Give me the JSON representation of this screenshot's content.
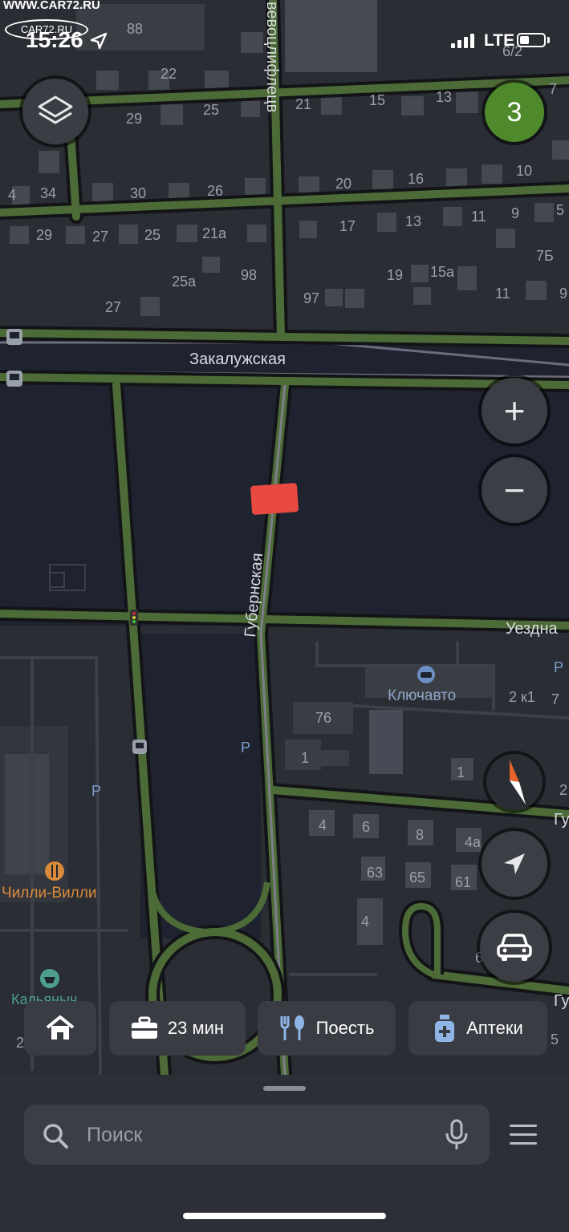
{
  "watermark": {
    "site": "WWW.CAR72.RU",
    "logo": "CAR72.RU"
  },
  "status_bar": {
    "time": "15:26",
    "network": "LTE",
    "battery_level": 0.35
  },
  "traffic": {
    "score": "3",
    "color": "#4e8a2c"
  },
  "map": {
    "streets": [
      "Закалужская",
      "Губернская",
      "Уездна",
      "вевоцлифлецв",
      "Гу",
      "Гу"
    ],
    "house_numbers": [
      "88",
      "22",
      "21",
      "15",
      "13",
      "7",
      "29",
      "25",
      "34",
      "30",
      "26",
      "20",
      "16",
      "10",
      "29",
      "27",
      "25",
      "21а",
      "17",
      "13",
      "11",
      "9",
      "5",
      "98",
      "19",
      "15а",
      "7Б",
      "25а",
      "27",
      "97",
      "11",
      "9",
      "6/2",
      "76",
      "1",
      "2 к1",
      "7",
      "1",
      "2",
      "4",
      "6",
      "8",
      "4а",
      "63",
      "65",
      "61",
      "4",
      "6",
      "10",
      "5",
      "2",
      "4"
    ],
    "pois": [
      {
        "name": "Ключавто",
        "icon": "car-service-icon"
      },
      {
        "name": "Чилли-Вилли",
        "icon": "restaurant-icon"
      },
      {
        "name": "Кальяныч",
        "icon": "hookah-icon"
      }
    ],
    "accent_road": "#4d6b36",
    "water": "#1f2330"
  },
  "controls": {
    "layers": "layers-icon",
    "zoom_in": "+",
    "zoom_out": "−",
    "compass": "compass-icon",
    "locate": "navigation-arrow-icon",
    "drive_mode": "car-icon"
  },
  "chips": [
    {
      "label": "",
      "icon": "home-icon"
    },
    {
      "label": "23 мин",
      "icon": "briefcase-icon"
    },
    {
      "label": "Поесть",
      "icon": "fork-icon"
    },
    {
      "label": "Аптеки",
      "icon": "pharmacy-icon"
    }
  ],
  "search": {
    "placeholder": "Поиск"
  }
}
